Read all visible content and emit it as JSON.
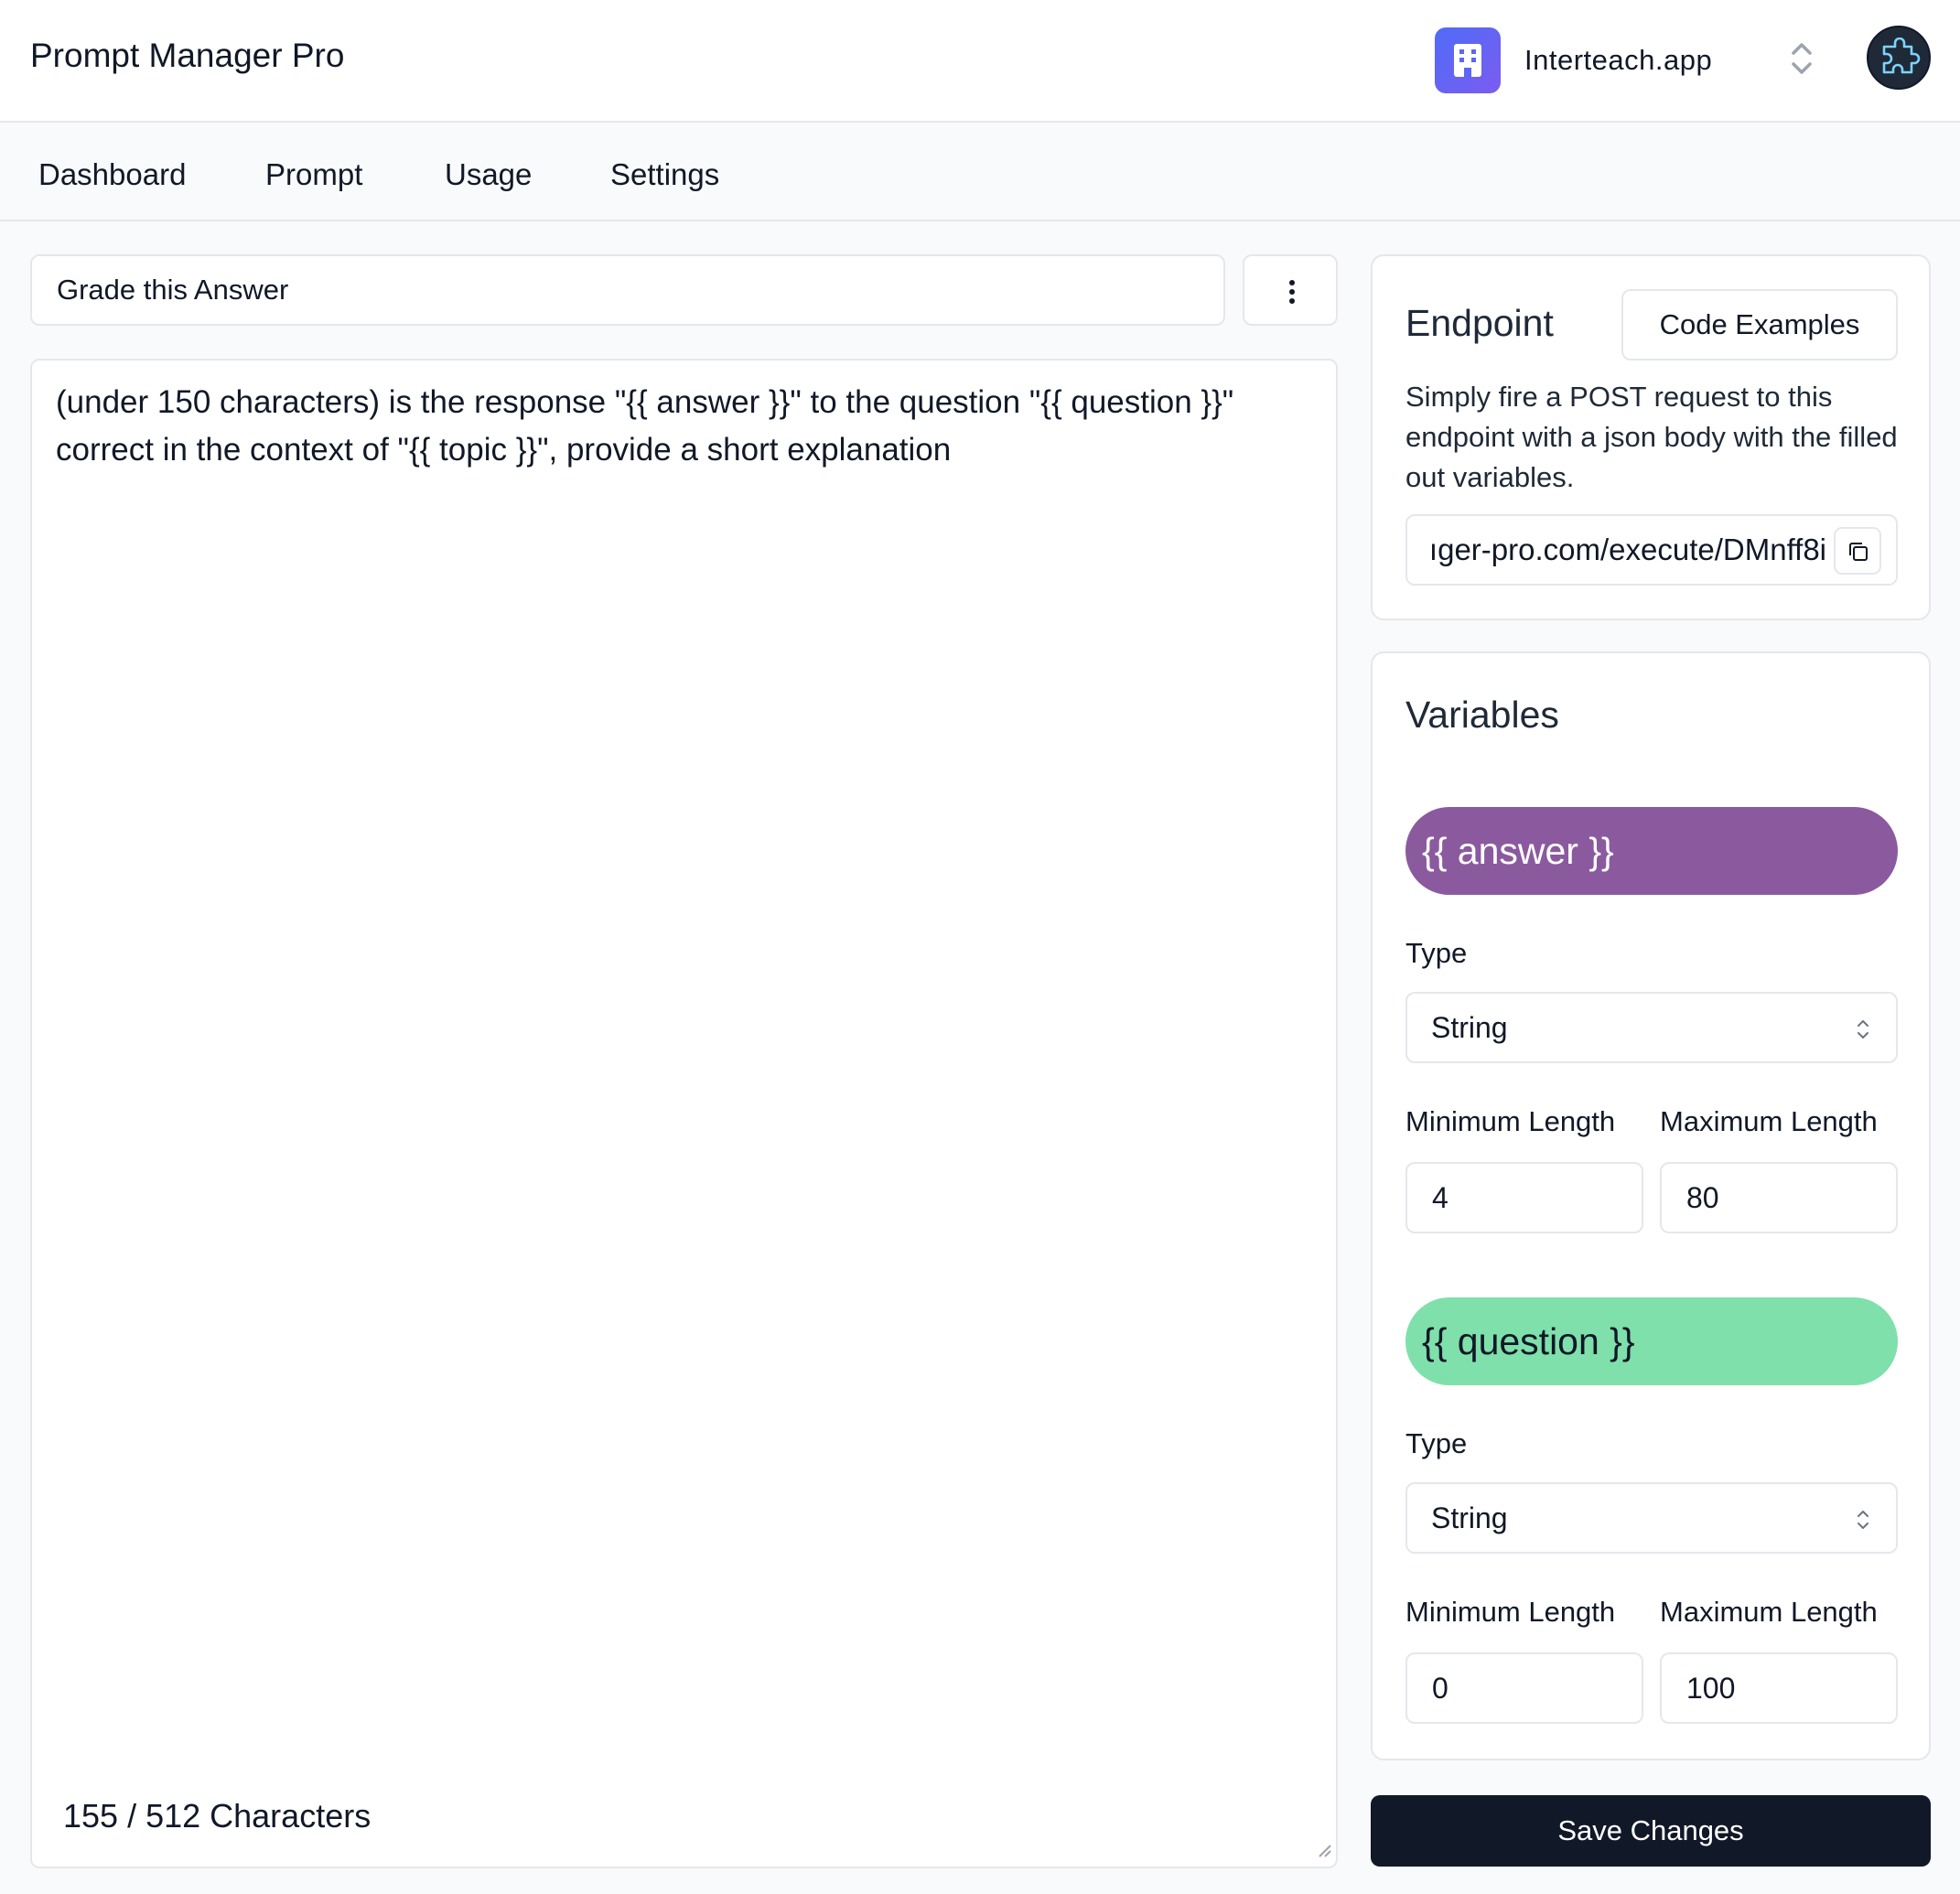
{
  "header": {
    "app_title": "Prompt Manager Pro",
    "org_name": "Interteach.app",
    "org_logo_icon": "building-icon",
    "switch_icon": "chevron-up-down-icon",
    "avatar_icon": "puzzle-icon"
  },
  "tabs": [
    {
      "label": "Dashboard"
    },
    {
      "label": "Prompt"
    },
    {
      "label": "Usage"
    },
    {
      "label": "Settings"
    }
  ],
  "prompt": {
    "name": "Grade this Answer",
    "more_icon": "vertical-dots-icon",
    "text": "(under 150 characters) is the response \"{{ answer }}\" to the question \"{{ question }}\" correct in the context of \"{{ topic }}\", provide a short explanation",
    "char_count": "155 / 512 Characters"
  },
  "endpoint": {
    "title": "Endpoint",
    "code_examples_label": "Code Examples",
    "description": "Simply fire a POST request to this endpoint with a json body with the filled out variables.",
    "url_visible": "ıger-pro.com/execute/DMnff8i",
    "copy_icon": "copy-icon"
  },
  "variables": {
    "title": "Variables",
    "items": [
      {
        "name": "{{ answer }}",
        "color": "#8b5a9e",
        "type_label": "Type",
        "type_value": "String",
        "min_label": "Minimum Length",
        "max_label": "Maximum Length",
        "min_value": "4",
        "max_value": "80"
      },
      {
        "name": "{{ question }}",
        "color": "#7fe0ab",
        "type_label": "Type",
        "type_value": "String",
        "min_label": "Minimum Length",
        "max_label": "Maximum Length",
        "min_value": "0",
        "max_value": "100"
      }
    ]
  },
  "save_label": "Save Changes"
}
